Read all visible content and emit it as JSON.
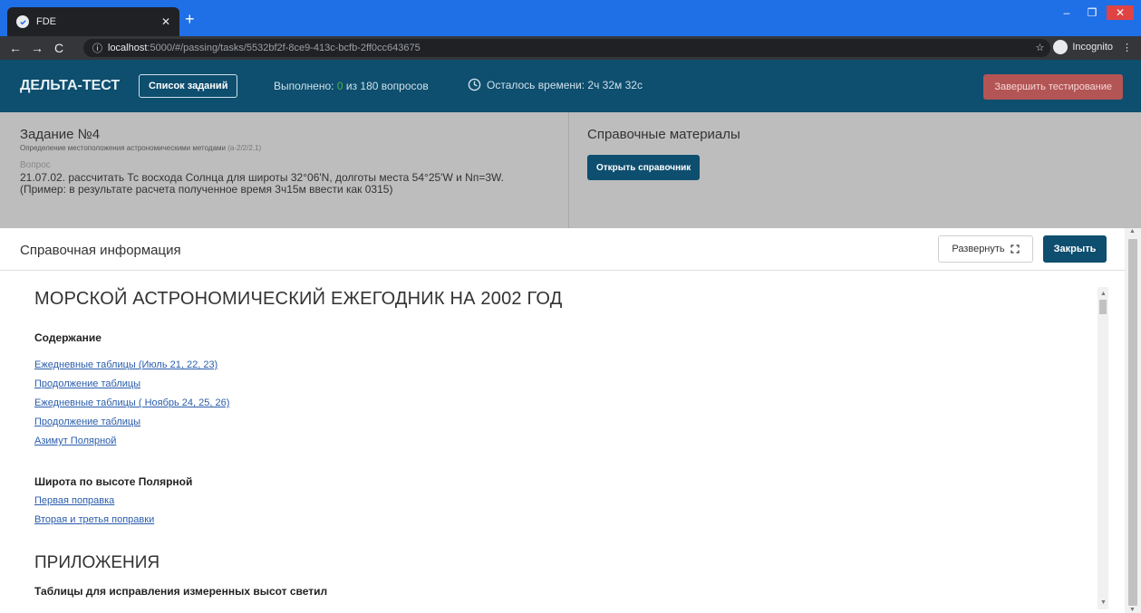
{
  "browser": {
    "tab_title": "FDE",
    "url_host": "localhost",
    "url_rest": ":5000/#/passing/tasks/5532bf2f-8ce9-413c-bcfb-2ff0cc643675",
    "incognito_label": "Incognito",
    "tab_bar_color": "#1f6fe6"
  },
  "header": {
    "brand": "ДЕЛЬТА-ТЕСТ",
    "task_list_label": "Список заданий",
    "progress_prefix": "Выполнено:",
    "progress_done": "0",
    "progress_suffix": "из 180 вопросов",
    "timer_text": "Осталось времени: 2ч 32м 32с",
    "finish_label": "Завершить тестирование",
    "color": "#0e4e6e"
  },
  "task": {
    "title": "Задание №4",
    "subtitle": "Определение местоположения астрономическими методами",
    "code": "(a-2/2/2.1)",
    "question_label": "Вопрос",
    "question_line1": "21.07.02. рассчитать Тс восхода Солнца для широты 32°06'N, долготы места 54°25'W и Nп=3W.",
    "question_line2": "(Пример: в результате расчета полученное время 3ч15м ввести как 0315)"
  },
  "reference": {
    "title": "Справочные материалы",
    "open_label": "Открыть справочник"
  },
  "modal": {
    "title": "Справочная информация",
    "expand_label": "Развернуть",
    "close_label": "Закрыть",
    "heading": "МОРСКОЙ АСТРОНОМИЧЕСКИЙ ЕЖЕГОДНИК НА 2002 ГОД",
    "toc_heading": "Содержание",
    "toc_links": [
      "Ежедневные таблицы (Июль 21, 22, 23)",
      "Продолжение таблицы",
      "Ежедневные таблицы ( Ноябрь 24, 25, 26)",
      "Продолжение таблицы",
      "Азимут Полярной"
    ],
    "polar_heading": "Широта по высоте Полярной",
    "polar_links": [
      "Первая поправка",
      "Вторая и третья поправки"
    ],
    "appendix_heading": "ПРИЛОЖЕНИЯ",
    "appendix_sub": "Таблицы для исправления измеренных высот светил"
  }
}
